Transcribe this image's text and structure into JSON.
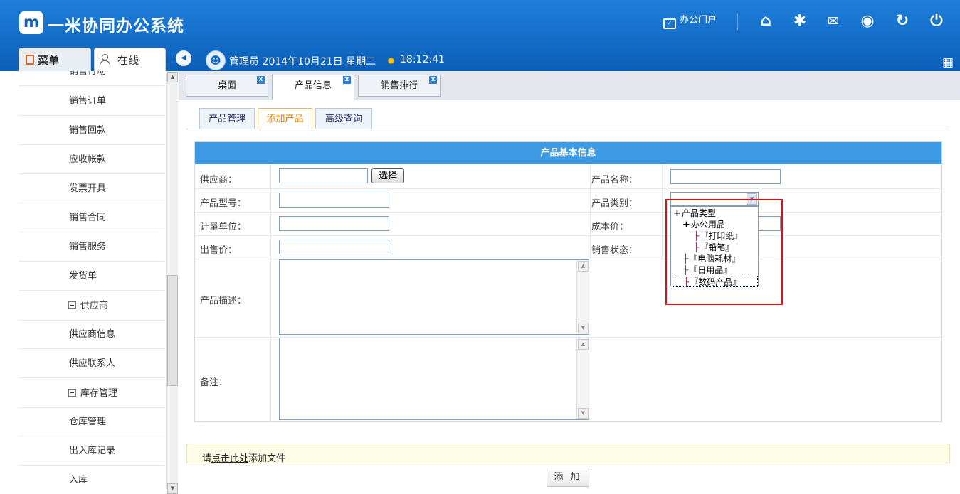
{
  "app": {
    "logo_text": "m",
    "title": "一米协同办公系统",
    "accent": "#0c5fb8"
  },
  "topnav": {
    "portal": "办公门户",
    "icons": [
      "home-icon",
      "gear-icon",
      "mail-icon",
      "user-circle-icon",
      "refresh-icon",
      "power-icon"
    ]
  },
  "sidebar_tabs": {
    "menu": "菜单",
    "online": "在线"
  },
  "status": {
    "user": "管理员",
    "date": "2014年10月21日 星期二",
    "time": "18:12:41"
  },
  "menu": {
    "partial": "销售行动",
    "items": [
      {
        "label": "销售订单"
      },
      {
        "label": "销售回款"
      },
      {
        "label": "应收帐款"
      },
      {
        "label": "发票开具"
      },
      {
        "label": "销售合同"
      },
      {
        "label": "销售服务"
      },
      {
        "label": "发货单"
      },
      {
        "label": "供应商",
        "group": true
      },
      {
        "label": "供应商信息"
      },
      {
        "label": "供应联系人"
      },
      {
        "label": "库存管理",
        "group": true
      },
      {
        "label": "仓库管理"
      },
      {
        "label": "出入库记录"
      },
      {
        "label": "入库"
      }
    ]
  },
  "page_tabs": [
    {
      "label": "桌面"
    },
    {
      "label": "产品信息"
    },
    {
      "label": "销售排行"
    }
  ],
  "sub_tabs": [
    {
      "label": "产品管理"
    },
    {
      "label": "添加产品"
    },
    {
      "label": "高级查询"
    }
  ],
  "form": {
    "header": "产品基本信息",
    "supplier": "供应商：",
    "select_btn": "选择",
    "product_name": "产品名称：",
    "model": "产品型号：",
    "category": "产品类别：",
    "unit": "计量单位：",
    "cost": "成本价：",
    "price": "出售价：",
    "sale_status": "销售状态：",
    "description": "产品描述：",
    "remark": "备注："
  },
  "tree": {
    "root": "产品类型",
    "office": "办公用品",
    "paper": "『打印纸』",
    "pencil": "『铅笔』",
    "computer": "『电脑耗材』",
    "daily": "『日用品』",
    "digital": "『数码产品』"
  },
  "upload": {
    "pre": "请",
    "link": "点击此处",
    "post": "添加文件"
  },
  "add_button": "添 加"
}
